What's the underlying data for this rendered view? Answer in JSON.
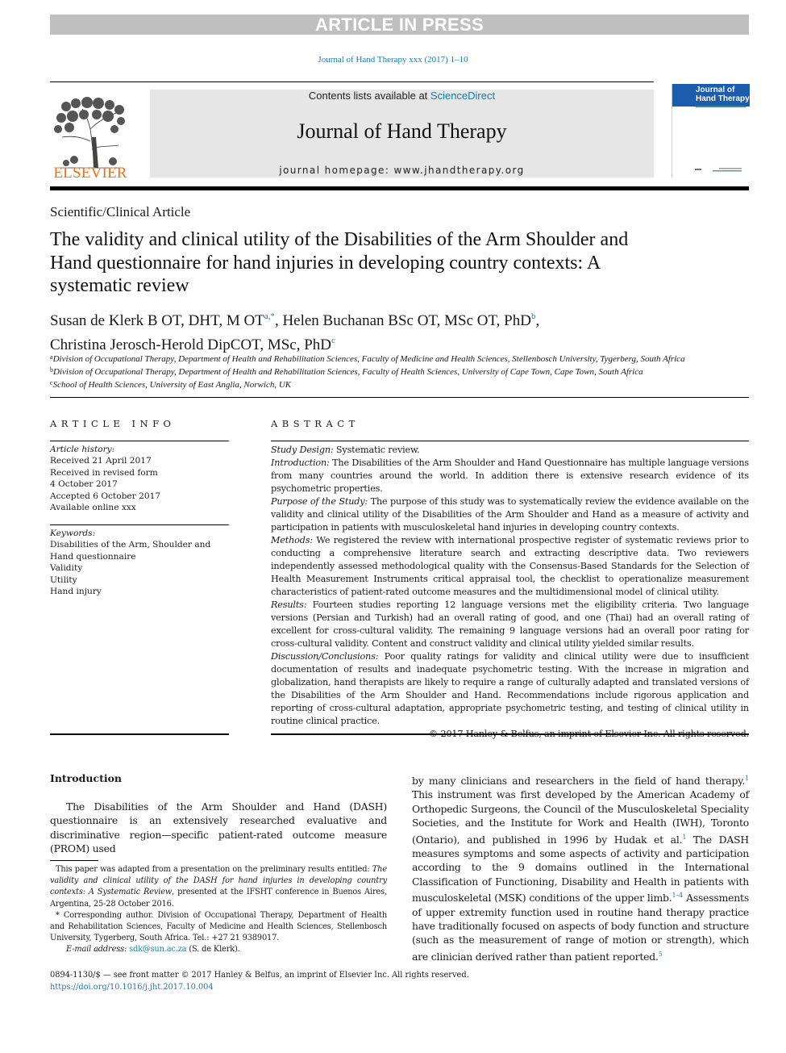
{
  "banner": {
    "label": "ARTICLE IN PRESS"
  },
  "header": {
    "journal_ref": "Journal of Hand Therapy xxx (2017) 1–10",
    "publisher": "ELSEVIER",
    "contents_prefix": "Contents lists available at ",
    "contents_link": "ScienceDirect",
    "journal_title": "Journal of Hand Therapy",
    "homepage": "journal homepage: www.jhandtherapy.org",
    "cover_title_line1": "Journal of",
    "cover_title_line2": "Hand Therapy",
    "brand_color": "#e9711c",
    "link_color": "#1f7aa8",
    "cover_color": "#1c5cae"
  },
  "article": {
    "type": "Scientific/Clinical Article",
    "title": "The validity and clinical utility of the Disabilities of the Arm Shoulder and Hand questionnaire for hand injuries in developing country contexts: A systematic review",
    "authors": [
      {
        "name": "Susan de Klerk B OT, DHT, M OT",
        "sup": "a,*",
        "sep": ", "
      },
      {
        "name": "Helen Buchanan BSc OT, MSc OT, PhD",
        "sup": "b",
        "sep": ","
      },
      {
        "name": "Christina Jerosch-Herold DipCOT, MSc, PhD",
        "sup": "c",
        "sep": ""
      }
    ],
    "affiliations": [
      {
        "key": "a",
        "text": "Division of Occupational Therapy, Department of Health and Rehabilitation Sciences, Faculty of Medicine and Health Sciences, Stellenbosch University, Tygerberg, South Africa"
      },
      {
        "key": "b",
        "text": "Division of Occupational Therapy, Department of Health and Rehabilitation Sciences, Faculty of Health Sciences, University of Cape Town, Cape Town, South Africa"
      },
      {
        "key": "c",
        "text": "School of Health Sciences, University of East Anglia, Norwich, UK"
      }
    ]
  },
  "article_info": {
    "heading": "ARTICLE INFO",
    "history_label": "Article history:",
    "history": [
      "Received 21 April 2017",
      "Received in revised form",
      "4 October 2017",
      "Accepted 6 October 2017",
      "Available online xxx"
    ],
    "keywords_label": "Keywords:",
    "keywords": [
      "Disabilities of the Arm, Shoulder and Hand questionnaire",
      "Validity",
      "Utility",
      "Hand injury"
    ]
  },
  "abstract": {
    "heading": "ABSTRACT",
    "sections": [
      {
        "label": "Study Design:",
        "text": " Systematic review."
      },
      {
        "label": "Introduction:",
        "text": " The Disabilities of the Arm Shoulder and Hand Questionnaire has multiple language versions from many countries around the world. In addition there is extensive research evidence of its psychometric properties."
      },
      {
        "label": "Purpose of the Study:",
        "text": " The purpose of this study was to systematically review the evidence available on the validity and clinical utility of the Disabilities of the Arm Shoulder and Hand as a measure of activity and participation in patients with musculoskeletal hand injuries in developing country contexts."
      },
      {
        "label": "Methods:",
        "text": " We registered the review with international prospective register of systematic reviews prior to conducting a comprehensive literature search and extracting descriptive data. Two reviewers independently assessed methodological quality with the Consensus-Based Standards for the Selection of Health Measurement Instruments critical appraisal tool, the checklist to operationalize measurement characteristics of patient-rated outcome measures and the multidimensional model of clinical utility."
      },
      {
        "label": "Results:",
        "text": " Fourteen studies reporting 12 language versions met the eligibility criteria. Two language versions (Persian and Turkish) had an overall rating of good, and one (Thai) had an overall rating of excellent for cross-cultural validity. The remaining 9 language versions had an overall poor rating for cross-cultural validity. Content and construct validity and clinical utility yielded similar results."
      },
      {
        "label": "Discussion/Conclusions:",
        "text": " Poor quality ratings for validity and clinical utility were due to insufficient documentation of results and inadequate psychometric testing. With the increase in migration and globalization, hand therapists are likely to require a range of culturally adapted and translated versions of the Disabilities of the Arm Shoulder and Hand. Recommendations include rigorous application and reporting of cross-cultural adaptation, appropriate psychometric testing, and testing of clinical utility in routine clinical practice."
      }
    ],
    "copyright": "© 2017 Hanley & Belfus, an imprint of Elsevier Inc. All rights reserved."
  },
  "introduction": {
    "heading": "Introduction",
    "left_para": "The Disabilities of the Arm Shoulder and Hand (DASH) questionnaire is an extensively researched evaluative and discriminative region—specific patient-rated outcome measure (PROM) used",
    "right_parts": [
      {
        "text": "by many clinicians and researchers in the field of hand therapy.",
        "ref": "1"
      },
      {
        "text": " This instrument was first developed by the American Academy of Orthopedic Surgeons, the Council of the Musculoskeletal Speciality Societies, and the Institute for Work and Health (IWH), Toronto (Ontario), and published in 1996 by Hudak et al.",
        "ref": "1"
      },
      {
        "text": " The DASH measures symptoms and some aspects of activity and participation according to the 9 domains outlined in the International Classification of Functioning, Disability and Health in patients with musculoskeletal (MSK) conditions of the upper limb.",
        "ref": "1–4"
      },
      {
        "text": " Assessments of upper extremity function used in routine hand therapy practice have traditionally focused on aspects of body function and structure (such as the measurement of range of motion or strength), which are clinician derived rather than patient reported.",
        "ref": "5"
      }
    ]
  },
  "footnotes": {
    "note1_prefix": "This paper was adapted from a presentation on the preliminary results entitled: ",
    "note1_title": "The validity and clinical utility of the DASH for hand injuries in developing country contexts: A Systematic Review",
    "note1_suffix": ", presented at the IFSHT conference in Buenos Aires, Argentina, 25-28 October 2016.",
    "note2": "* Corresponding author. Division of Occupational Therapy, Department of Health and Rehabilitation Sciences, Faculty of Medicine and Health Sciences, Stellenbosch University, Tygerberg, South Africa. Tel.: +27 21 9389017.",
    "email_label": "E-mail address:",
    "email": "sdk@sun.ac.za",
    "email_suffix": " (S. de Klerk)."
  },
  "footer": {
    "front_matter": "0894-1130/$ — see front matter © 2017 Hanley & Belfus, an imprint of Elsevier Inc. All rights reserved.",
    "doi": "https://doi.org/10.1016/j.jht.2017.10.004"
  }
}
